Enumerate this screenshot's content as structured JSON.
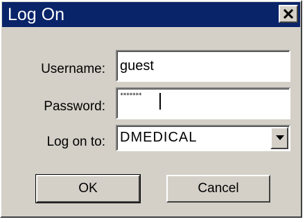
{
  "window": {
    "title": "Log On",
    "titlebar_color": "#0a246a",
    "face_color": "#d4d0c8"
  },
  "controls": {
    "close_icon": "close-icon"
  },
  "form": {
    "username_label": "Username:",
    "username_value": "guest",
    "password_label": "Password:",
    "password_masked": "*******",
    "domain_label": "Log on to:",
    "domain_value": "DMEDICAL",
    "dropdown_icon": "chevron-down-icon"
  },
  "buttons": {
    "ok_label": "OK",
    "cancel_label": "Cancel"
  }
}
